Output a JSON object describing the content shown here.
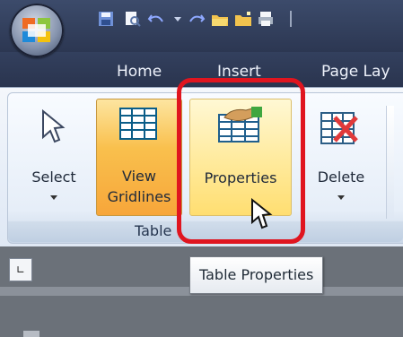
{
  "ribbon": {
    "tabs": [
      "Home",
      "Insert",
      "Page Lay"
    ],
    "group_label": "Table",
    "buttons": {
      "select": "Select",
      "view_gridlines": "View Gridlines",
      "properties": "Properties",
      "delete": "Delete"
    }
  },
  "tooltip": "Table Properties",
  "colors": {
    "highlight": "#e0151f",
    "active_button": "#f7a63a"
  }
}
